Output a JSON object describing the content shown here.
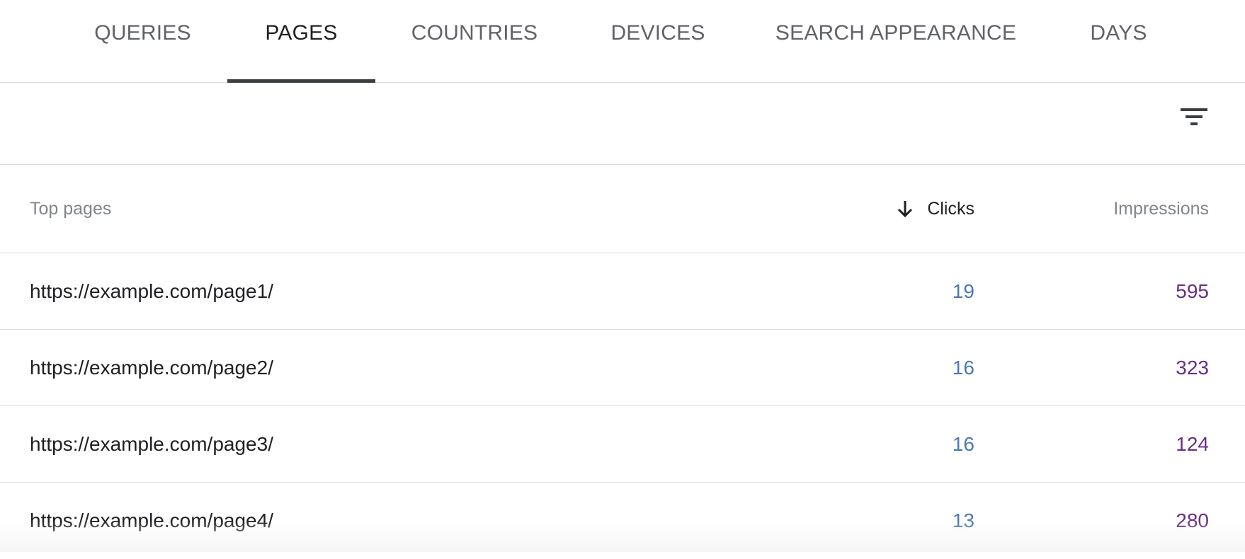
{
  "tabs": [
    {
      "label": "QUERIES",
      "active": false
    },
    {
      "label": "PAGES",
      "active": true
    },
    {
      "label": "COUNTRIES",
      "active": false
    },
    {
      "label": "DEVICES",
      "active": false
    },
    {
      "label": "SEARCH APPEARANCE",
      "active": false
    },
    {
      "label": "DAYS",
      "active": false
    }
  ],
  "toolbar": {
    "filter_icon": "filter-list-icon"
  },
  "table": {
    "headers": {
      "page": "Top pages",
      "clicks": "Clicks",
      "impressions": "Impressions",
      "sort_icon": "arrow-downward-icon",
      "sorted_by": "Clicks"
    },
    "rows": [
      {
        "page": "https://example.com/page1/",
        "clicks": "19",
        "impressions": "595"
      },
      {
        "page": "https://example.com/page2/",
        "clicks": "16",
        "impressions": "323"
      },
      {
        "page": "https://example.com/page3/",
        "clicks": "16",
        "impressions": "124"
      },
      {
        "page": "https://example.com/page4/",
        "clicks": "13",
        "impressions": "280"
      }
    ]
  },
  "colors": {
    "clicks": "#4a78b5",
    "impressions": "#6a2d8a",
    "active_tab_indicator": "#3c4043"
  }
}
